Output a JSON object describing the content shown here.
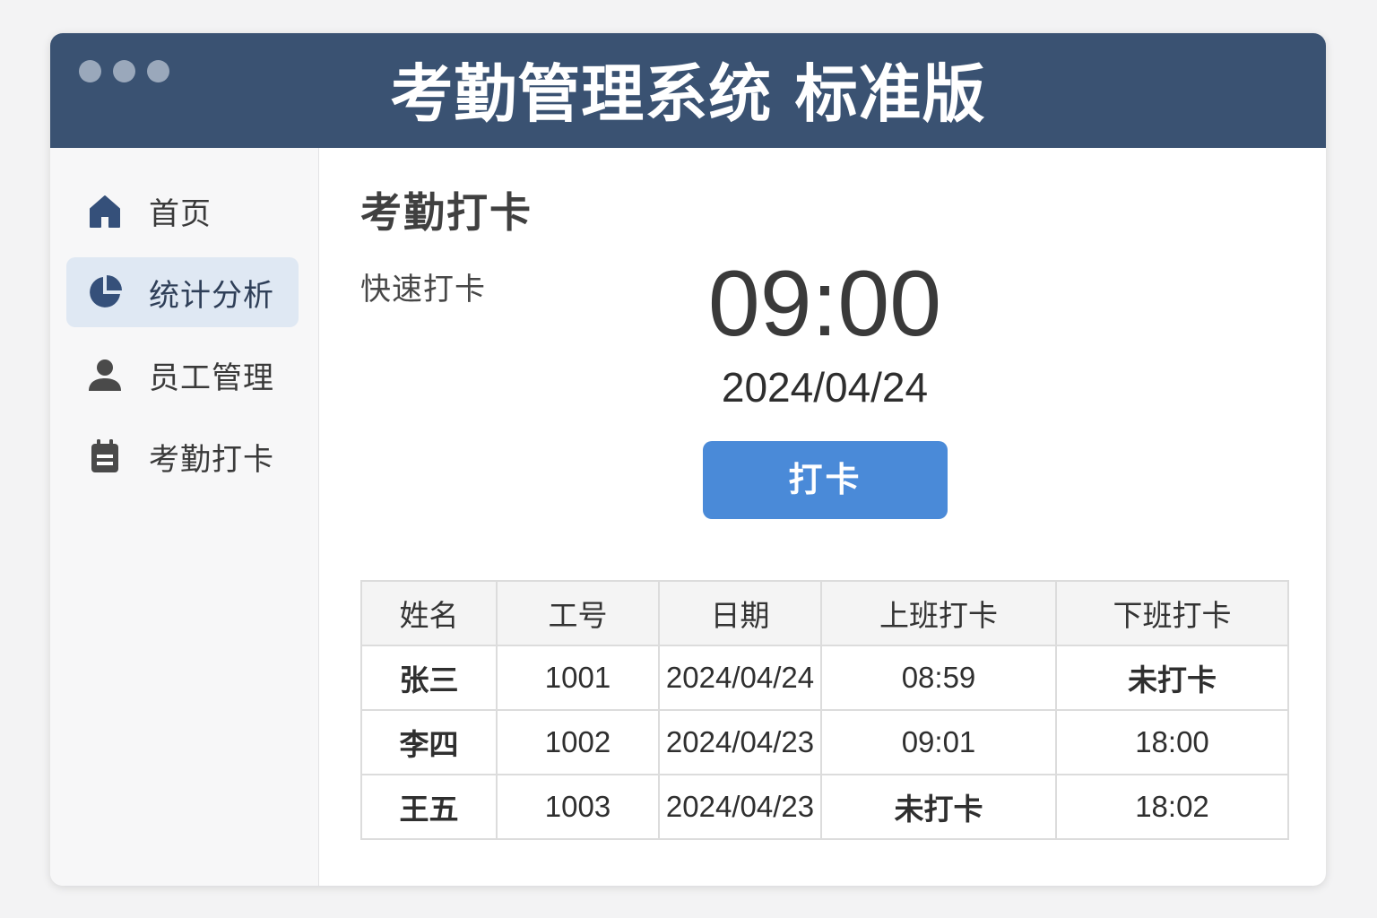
{
  "window": {
    "title": "考勤管理系统 标准版"
  },
  "sidebar": {
    "items": [
      {
        "label": "首页",
        "icon": "home-icon"
      },
      {
        "label": "统计分析",
        "icon": "pie-chart-icon",
        "active": true
      },
      {
        "label": "员工管理",
        "icon": "user-icon"
      },
      {
        "label": "考勤打卡",
        "icon": "clipboard-icon"
      }
    ]
  },
  "main": {
    "title": "考勤打卡",
    "quick_label": "快速打卡",
    "time": "09:00",
    "date": "2024/04/24",
    "punch_button": "打卡"
  },
  "table": {
    "headers": [
      "姓名",
      "工号",
      "日期",
      "上班打卡",
      "下班打卡"
    ],
    "rows": [
      [
        "张三",
        "1001",
        "2024/04/24",
        "08:59",
        "未打卡"
      ],
      [
        "李四",
        "1002",
        "2024/04/23",
        "09:01",
        "18:00"
      ],
      [
        "王五",
        "1003",
        "2024/04/23",
        "未打卡",
        "18:02"
      ]
    ]
  },
  "colors": {
    "titlebar": "#3a5272",
    "accent": "#4a8ad8",
    "active_nav": "#dfe8f3"
  }
}
